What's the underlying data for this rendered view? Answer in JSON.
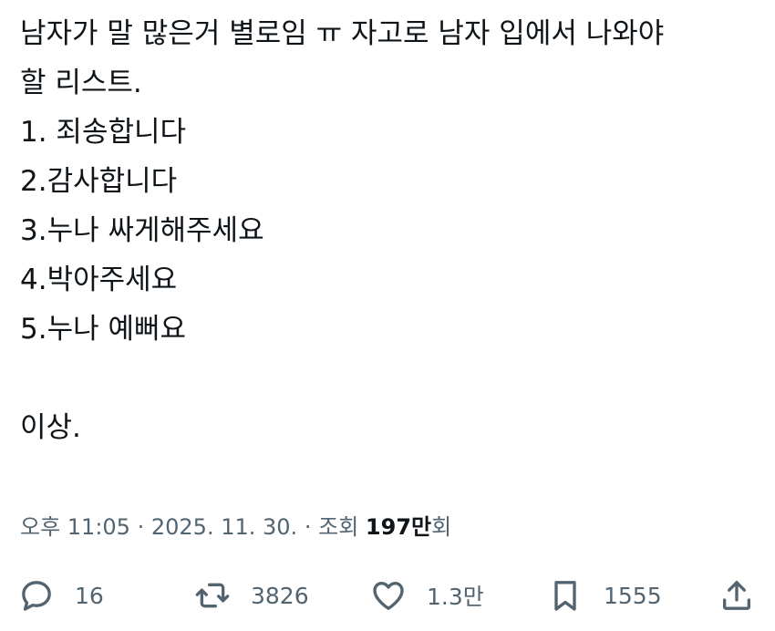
{
  "tweet": {
    "lines": [
      "남자가 말 많은거 별로임 ㅠ 자고로 남자 입에서 나와야",
      "할 리스트.",
      "1. 죄송합니다",
      "2.감사합니다",
      "3.누나 싸게해주세요",
      "4.박아주세요",
      "5.누나 예뻐요",
      "",
      "이상."
    ]
  },
  "meta": {
    "time": "오후 11:05",
    "separator": "·",
    "date": "2025. 11. 30.",
    "views_label": "조회",
    "views_count": "197만",
    "views_suffix": "회"
  },
  "actions": {
    "reply_count": "16",
    "retweet_count": "3826",
    "like_count": "1.3만",
    "bookmark_count": "1555"
  },
  "icons": {
    "reply": "reply-icon",
    "retweet": "retweet-icon",
    "like": "heart-icon",
    "bookmark": "bookmark-icon",
    "share": "share-icon"
  },
  "colors": {
    "text": "#0f1419",
    "secondary": "#536471",
    "background": "#ffffff"
  }
}
